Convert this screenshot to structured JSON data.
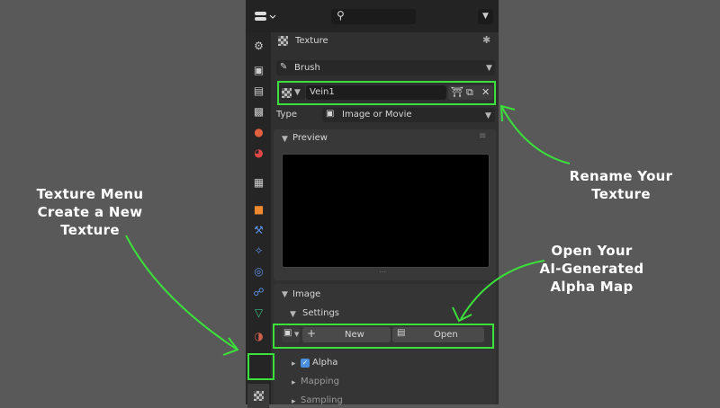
{
  "topbar": {
    "search_icon": "search-icon",
    "editor_icon": "properties-editor-icon"
  },
  "header": {
    "title": "Texture"
  },
  "brush": {
    "label": "Brush"
  },
  "texture_name": {
    "value": "Vein1"
  },
  "type": {
    "label": "Type",
    "value": "Image or Movie"
  },
  "preview": {
    "label": "Preview"
  },
  "image_section": {
    "label": "Image",
    "settings_label": "Settings"
  },
  "buttons": {
    "new_label": "New",
    "open_label": "Open"
  },
  "subpanels": {
    "alpha": "Alpha",
    "mapping": "Mapping",
    "sampling": "Sampling"
  },
  "annotations": {
    "texture_menu": [
      "Texture Menu",
      "Create a New",
      "Texture"
    ],
    "rename": [
      "Rename Your",
      "Texture"
    ],
    "open_map": [
      "Open Your",
      "AI-Generated",
      "Alpha Map"
    ]
  },
  "colors": {
    "highlight": "#3be03b",
    "background": "#595959",
    "panel": "#303030"
  }
}
